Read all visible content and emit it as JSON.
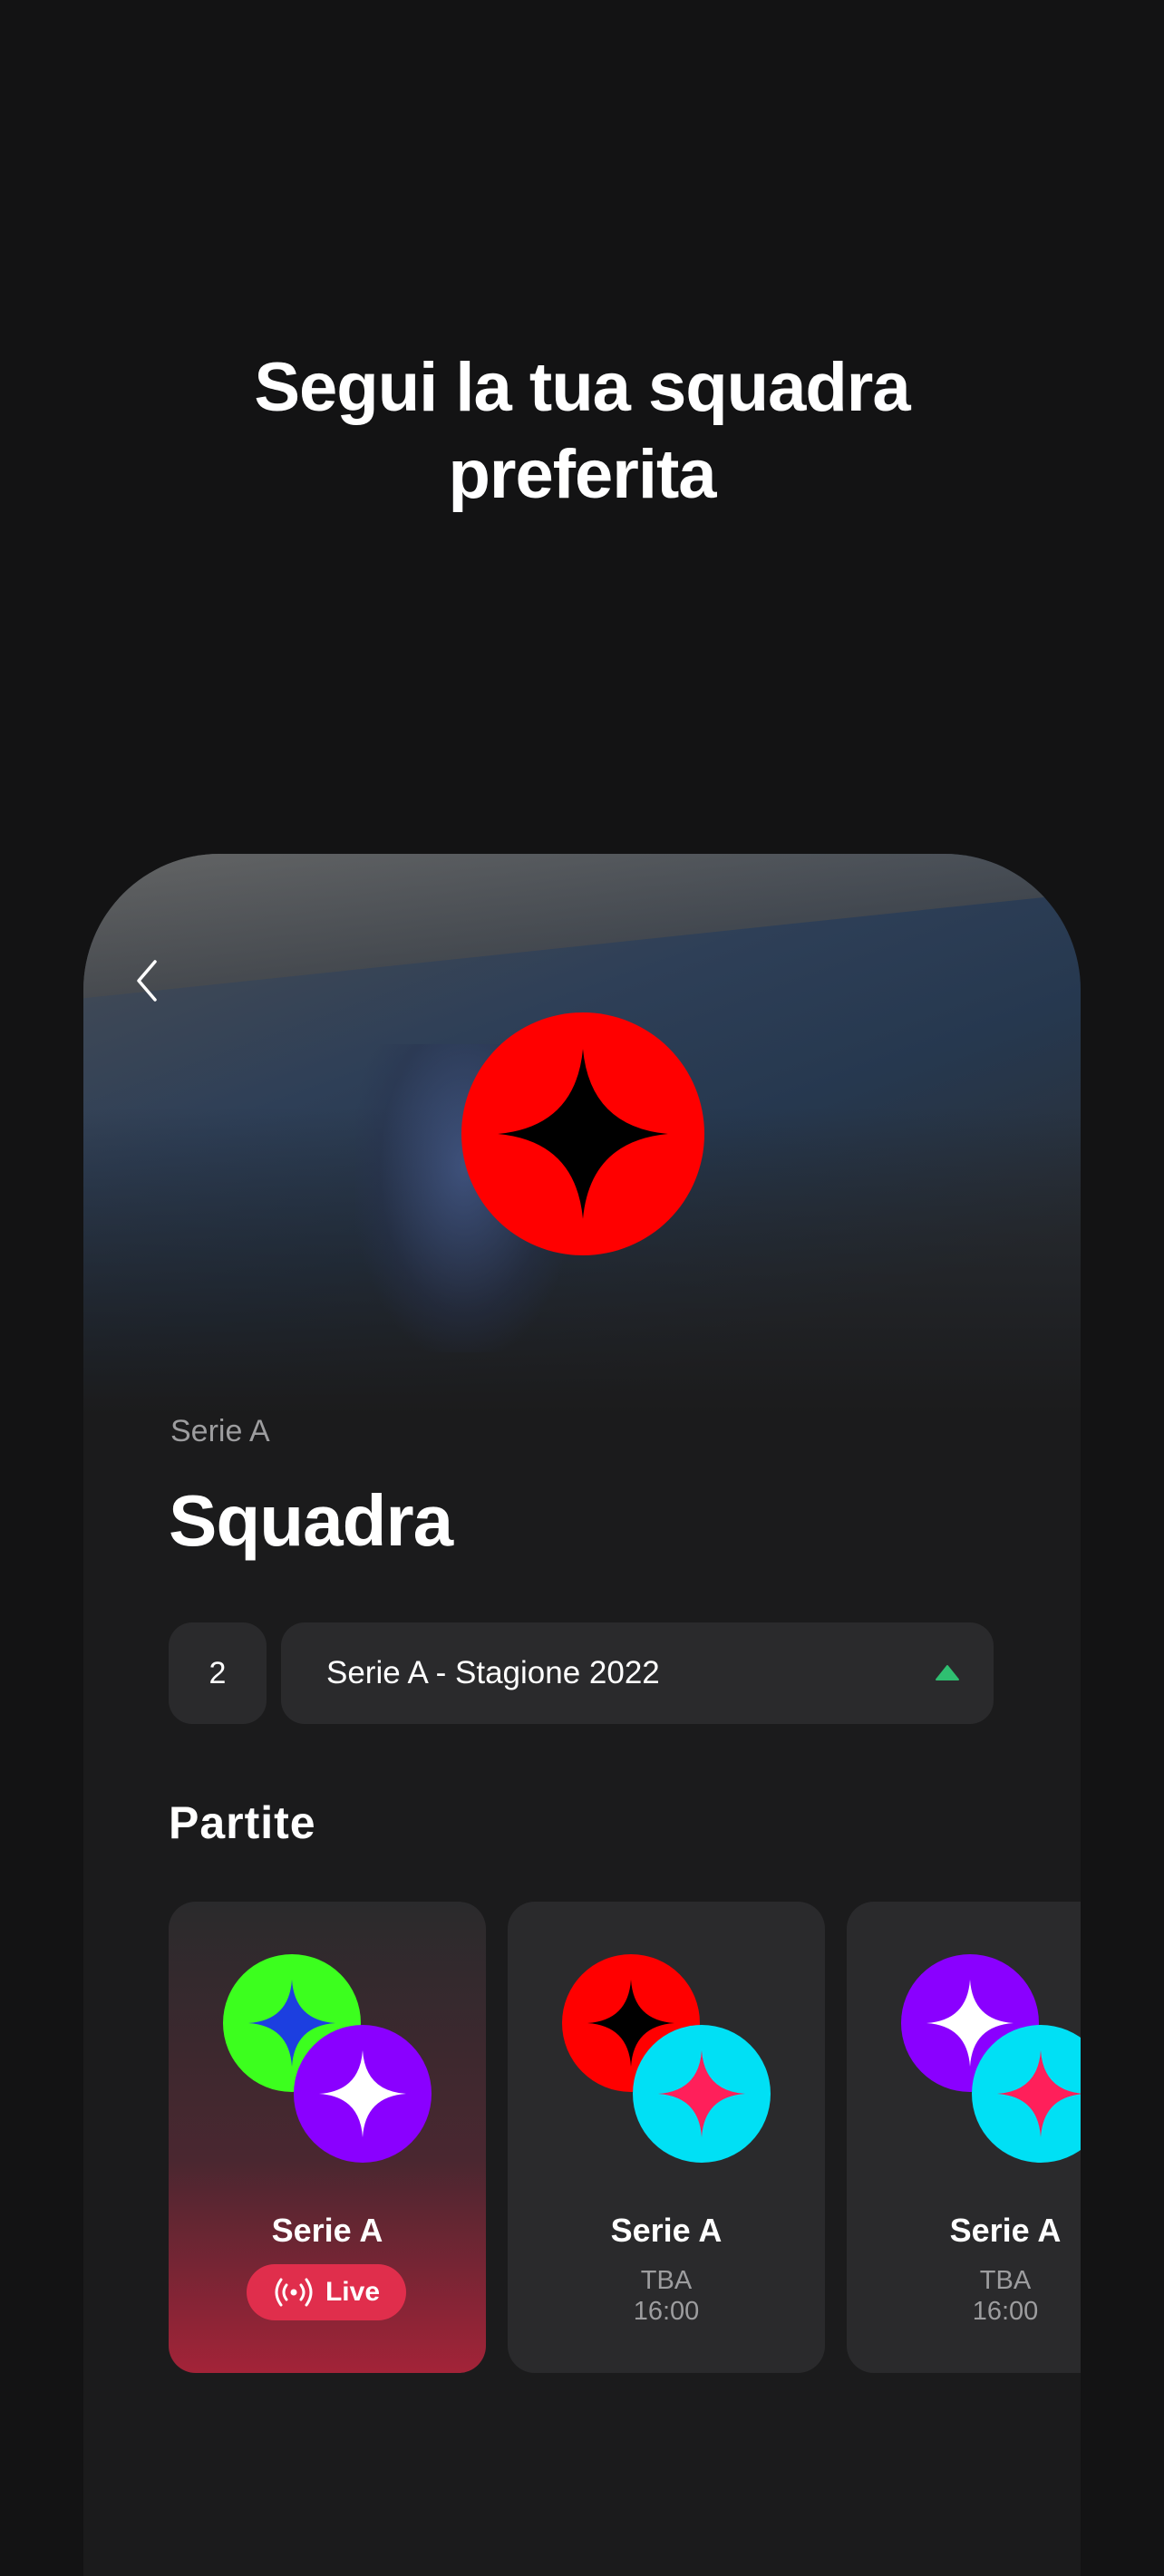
{
  "headline": {
    "line1": "Segui la tua squadra",
    "line2": "preferita"
  },
  "team": {
    "league": "Serie A",
    "name": "Squadra",
    "logo_colors": {
      "bg": "#ff0000",
      "star": "#000000"
    }
  },
  "filters": {
    "round": "2",
    "season": "Serie A - Stagione 2022",
    "accent": "#2fbf71"
  },
  "matches": {
    "title": "Partite",
    "items": [
      {
        "competition": "Serie A",
        "status": "Live",
        "home": {
          "bg": "#3cff1e",
          "star": "#1c3fe0"
        },
        "away": {
          "bg": "#8a00ff",
          "star": "#ffffff"
        }
      },
      {
        "competition": "Serie A",
        "date": "TBA",
        "time": "16:00",
        "home": {
          "bg": "#ff0000",
          "star": "#000000"
        },
        "away": {
          "bg": "#00e0f5",
          "star": "#ff1f5a"
        }
      },
      {
        "competition": "Serie A",
        "date": "TBA",
        "time": "16:00",
        "home": {
          "bg": "#8a00ff",
          "star": "#ffffff"
        },
        "away": {
          "bg": "#00e0f5",
          "star": "#ff1f5a"
        }
      }
    ]
  },
  "icons": [
    "back-chevron-icon",
    "dropdown-arrow-icon",
    "live-broadcast-icon"
  ]
}
